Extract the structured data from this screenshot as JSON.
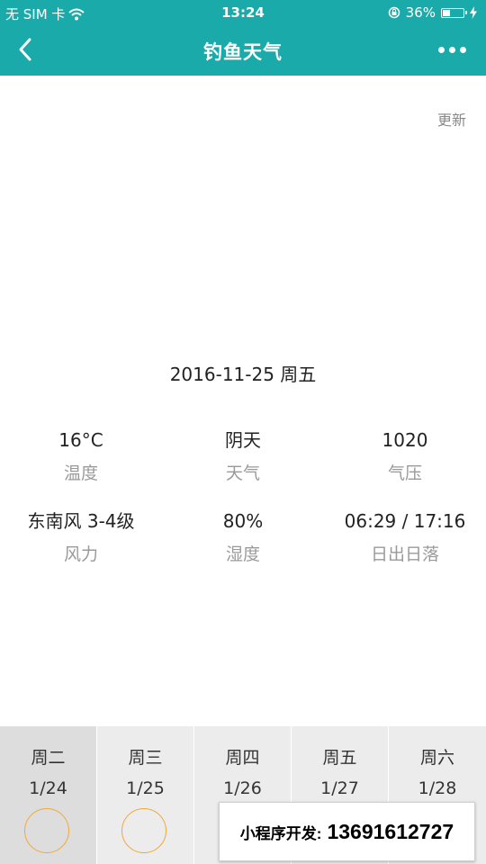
{
  "status_bar": {
    "carrier": "无 SIM 卡",
    "time": "13:24",
    "battery_percent": "36%",
    "battery_level": 0.36,
    "icons": [
      "wifi-icon",
      "orientation-lock-icon",
      "battery-icon",
      "charging-icon"
    ]
  },
  "nav": {
    "title": "钓鱼天气",
    "back_icon": "chevron-left-icon",
    "more_icon": "more-dots-icon",
    "color": "#1aaaa9"
  },
  "refresh_label": "更新",
  "date": "2016-11-25 周五",
  "metrics": [
    {
      "value": "16°C",
      "label": "温度"
    },
    {
      "value": "阴天",
      "label": "天气"
    },
    {
      "value": "1020",
      "label": "气压"
    },
    {
      "value": "东南风 3-4级",
      "label": "风力"
    },
    {
      "value": "80%",
      "label": "湿度"
    },
    {
      "value": "06:29 / 17:16",
      "label": "日出日落"
    }
  ],
  "forecast": [
    {
      "weekday": "周二",
      "date": "1/24",
      "selected": true
    },
    {
      "weekday": "周三",
      "date": "1/25",
      "selected": false
    },
    {
      "weekday": "周四",
      "date": "1/26",
      "selected": false
    },
    {
      "weekday": "周五",
      "date": "1/27",
      "selected": false
    },
    {
      "weekday": "周六",
      "date": "1/28",
      "selected": false
    }
  ],
  "ad": {
    "label": "小程序开发:",
    "phone": "13691612727"
  },
  "colors": {
    "accent": "#1aaaa9",
    "circle": "#f1a83a",
    "muted_text": "#9a9a9a"
  }
}
